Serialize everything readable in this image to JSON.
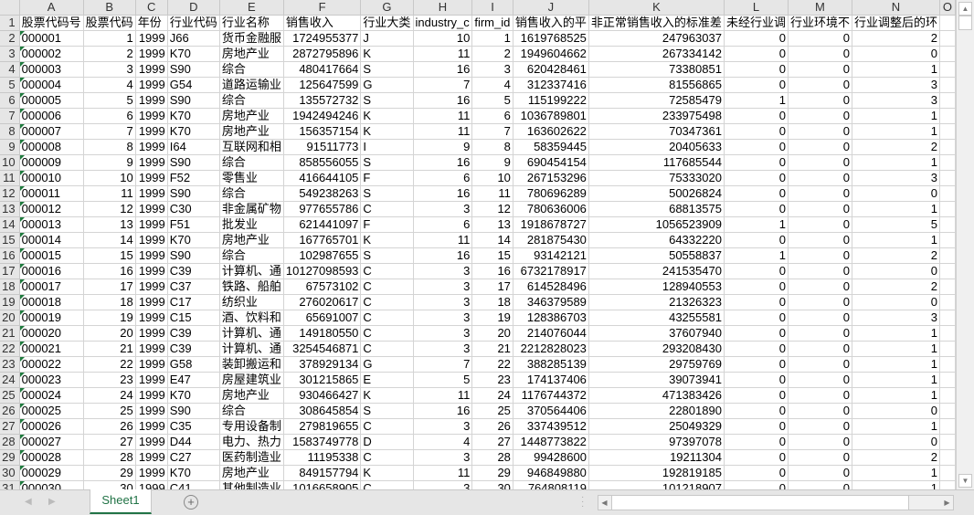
{
  "sheet": {
    "column_letters": [
      "A",
      "B",
      "C",
      "D",
      "E",
      "F",
      "G",
      "H",
      "I",
      "J",
      "K",
      "L",
      "M",
      "N",
      "O"
    ],
    "headers": [
      "股票代码号",
      "股票代码",
      "年份",
      "行业代码",
      "行业名称",
      "销售收入",
      "行业大类",
      "industry_c",
      "firm_id",
      "销售收入的平",
      "非正常销售收入的标准差",
      "未经行业调",
      "行业环境不",
      "行业调整后的环",
      ""
    ],
    "rows": [
      [
        "000001",
        "1",
        "1999",
        "J66",
        "货币金融服",
        "1724955377",
        "J",
        "10",
        "1",
        "1619768525",
        "247963037",
        "0",
        "0",
        "2"
      ],
      [
        "000002",
        "2",
        "1999",
        "K70",
        "房地产业",
        "2872795896",
        "K",
        "11",
        "2",
        "1949604662",
        "267334142",
        "0",
        "0",
        "0"
      ],
      [
        "000003",
        "3",
        "1999",
        "S90",
        "综合",
        "480417664",
        "S",
        "16",
        "3",
        "620428461",
        "73380851",
        "0",
        "0",
        "1"
      ],
      [
        "000004",
        "4",
        "1999",
        "G54",
        "道路运输业",
        "125647599",
        "G",
        "7",
        "4",
        "312337416",
        "81556865",
        "0",
        "0",
        "3"
      ],
      [
        "000005",
        "5",
        "1999",
        "S90",
        "综合",
        "135572732",
        "S",
        "16",
        "5",
        "115199222",
        "72585479",
        "1",
        "0",
        "3"
      ],
      [
        "000006",
        "6",
        "1999",
        "K70",
        "房地产业",
        "1942494246",
        "K",
        "11",
        "6",
        "1036789801",
        "233975498",
        "0",
        "0",
        "1"
      ],
      [
        "000007",
        "7",
        "1999",
        "K70",
        "房地产业",
        "156357154",
        "K",
        "11",
        "7",
        "163602622",
        "70347361",
        "0",
        "0",
        "1"
      ],
      [
        "000008",
        "8",
        "1999",
        "I64",
        "互联网和相",
        "91511773",
        "I",
        "9",
        "8",
        "58359445",
        "20405633",
        "0",
        "0",
        "2"
      ],
      [
        "000009",
        "9",
        "1999",
        "S90",
        "综合",
        "858556055",
        "S",
        "16",
        "9",
        "690454154",
        "117685544",
        "0",
        "0",
        "1"
      ],
      [
        "000010",
        "10",
        "1999",
        "F52",
        "零售业",
        "416644105",
        "F",
        "6",
        "10",
        "267153296",
        "75333020",
        "0",
        "0",
        "3"
      ],
      [
        "000011",
        "11",
        "1999",
        "S90",
        "综合",
        "549238263",
        "S",
        "16",
        "11",
        "780696289",
        "50026824",
        "0",
        "0",
        "0"
      ],
      [
        "000012",
        "12",
        "1999",
        "C30",
        "非金属矿物",
        "977655786",
        "C",
        "3",
        "12",
        "780636006",
        "68813575",
        "0",
        "0",
        "1"
      ],
      [
        "000013",
        "13",
        "1999",
        "F51",
        "批发业",
        "621441097",
        "F",
        "6",
        "13",
        "1918678727",
        "1056523909",
        "1",
        "0",
        "5"
      ],
      [
        "000014",
        "14",
        "1999",
        "K70",
        "房地产业",
        "167765701",
        "K",
        "11",
        "14",
        "281875430",
        "64332220",
        "0",
        "0",
        "1"
      ],
      [
        "000015",
        "15",
        "1999",
        "S90",
        "综合",
        "102987655",
        "S",
        "16",
        "15",
        "93142121",
        "50558837",
        "1",
        "0",
        "2"
      ],
      [
        "000016",
        "16",
        "1999",
        "C39",
        "计算机、通",
        "10127098593",
        "C",
        "3",
        "16",
        "6732178917",
        "241535470",
        "0",
        "0",
        "0"
      ],
      [
        "000017",
        "17",
        "1999",
        "C37",
        "铁路、船舶",
        "67573102",
        "C",
        "3",
        "17",
        "614528496",
        "128940553",
        "0",
        "0",
        "2"
      ],
      [
        "000018",
        "18",
        "1999",
        "C17",
        "纺织业",
        "276020617",
        "C",
        "3",
        "18",
        "346379589",
        "21326323",
        "0",
        "0",
        "0"
      ],
      [
        "000019",
        "19",
        "1999",
        "C15",
        "酒、饮料和",
        "65691007",
        "C",
        "3",
        "19",
        "128386703",
        "43255581",
        "0",
        "0",
        "3"
      ],
      [
        "000020",
        "20",
        "1999",
        "C39",
        "计算机、通",
        "149180550",
        "C",
        "3",
        "20",
        "214076044",
        "37607940",
        "0",
        "0",
        "1"
      ],
      [
        "000021",
        "21",
        "1999",
        "C39",
        "计算机、通",
        "3254546871",
        "C",
        "3",
        "21",
        "2212828023",
        "293208430",
        "0",
        "0",
        "1"
      ],
      [
        "000022",
        "22",
        "1999",
        "G58",
        "装卸搬运和",
        "378929134",
        "G",
        "7",
        "22",
        "388285139",
        "29759769",
        "0",
        "0",
        "1"
      ],
      [
        "000023",
        "23",
        "1999",
        "E47",
        "房屋建筑业",
        "301215865",
        "E",
        "5",
        "23",
        "174137406",
        "39073941",
        "0",
        "0",
        "1"
      ],
      [
        "000024",
        "24",
        "1999",
        "K70",
        "房地产业",
        "930466427",
        "K",
        "11",
        "24",
        "1176744372",
        "471383426",
        "0",
        "0",
        "1"
      ],
      [
        "000025",
        "25",
        "1999",
        "S90",
        "综合",
        "308645854",
        "S",
        "16",
        "25",
        "370564406",
        "22801890",
        "0",
        "0",
        "0"
      ],
      [
        "000026",
        "26",
        "1999",
        "C35",
        "专用设备制",
        "279819655",
        "C",
        "3",
        "26",
        "337439512",
        "25049329",
        "0",
        "0",
        "1"
      ],
      [
        "000027",
        "27",
        "1999",
        "D44",
        "电力、热力",
        "1583749778",
        "D",
        "4",
        "27",
        "1448773822",
        "97397078",
        "0",
        "0",
        "0"
      ],
      [
        "000028",
        "28",
        "1999",
        "C27",
        "医药制造业",
        "11195338",
        "C",
        "3",
        "28",
        "99428600",
        "19211304",
        "0",
        "0",
        "2"
      ],
      [
        "000029",
        "29",
        "1999",
        "K70",
        "房地产业",
        "849157794",
        "K",
        "11",
        "29",
        "946849880",
        "192819185",
        "0",
        "0",
        "1"
      ],
      [
        "000030",
        "30",
        "1999",
        "C41",
        "其他制造业",
        "1016658905",
        "C",
        "3",
        "30",
        "764808119",
        "101218907",
        "0",
        "0",
        "1"
      ]
    ]
  },
  "tabs": {
    "sheet1": "Sheet1",
    "add_icon": "plus-circle-icon"
  },
  "colors": {
    "accent": "#217346",
    "header_bg": "#e6e6e6",
    "gridline": "#d4d4d4"
  }
}
